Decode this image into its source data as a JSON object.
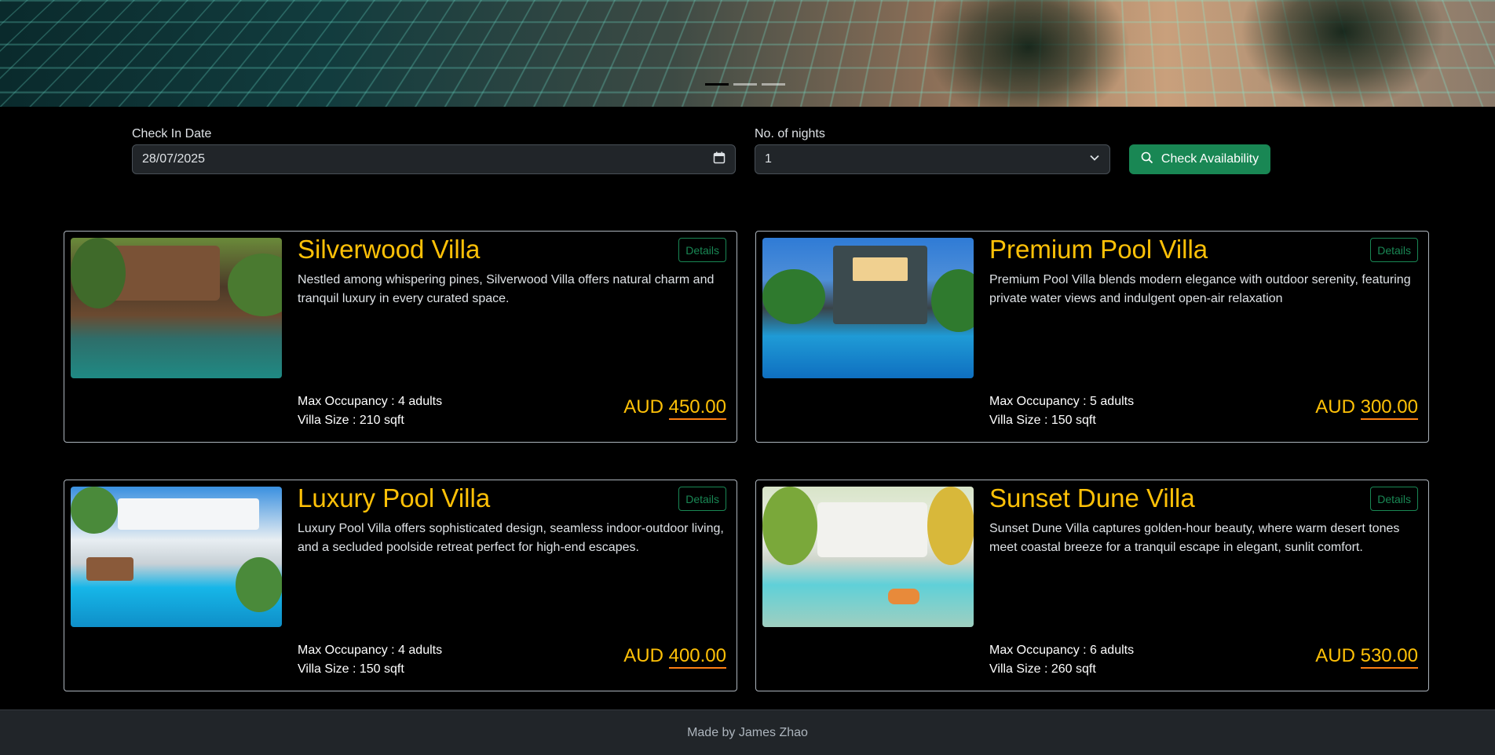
{
  "form": {
    "checkin_label": "Check In Date",
    "checkin_value": "28/07/2025",
    "nights_label": "No. of nights",
    "nights_value": "1",
    "check_button": "Check Availability"
  },
  "villas": [
    {
      "title": "Silverwood Villa",
      "description": "Nestled among whispering pines, Silverwood Villa offers natural charm and tranquil luxury in every curated space.",
      "details_label": "Details",
      "occupancy": "Max Occupancy : 4 adults",
      "size": "Villa Size : 210 sqft",
      "currency": "AUD",
      "price": "450.00"
    },
    {
      "title": "Premium Pool Villa",
      "description": "Premium Pool Villa blends modern elegance with outdoor serenity, featuring private water views and indulgent open-air relaxation",
      "details_label": "Details",
      "occupancy": "Max Occupancy : 5 adults",
      "size": "Villa Size : 150 sqft",
      "currency": "AUD",
      "price": "300.00"
    },
    {
      "title": "Luxury Pool Villa",
      "description": "Luxury Pool Villa offers sophisticated design, seamless indoor-outdoor living, and a secluded poolside retreat perfect for high-end escapes.",
      "details_label": "Details",
      "occupancy": "Max Occupancy : 4 adults",
      "size": "Villa Size : 150 sqft",
      "currency": "AUD",
      "price": "400.00"
    },
    {
      "title": "Sunset Dune Villa",
      "description": "Sunset Dune Villa captures golden-hour beauty, where warm desert tones meet coastal breeze for a tranquil escape in elegant, sunlit comfort.",
      "details_label": "Details",
      "occupancy": "Max Occupancy : 6 adults",
      "size": "Villa Size : 260 sqft",
      "currency": "AUD",
      "price": "530.00"
    }
  ],
  "footer": {
    "text": "Made by James Zhao"
  },
  "colors": {
    "accent": "#ffc107",
    "success": "#198754",
    "price_underline": "#fd7e14"
  }
}
